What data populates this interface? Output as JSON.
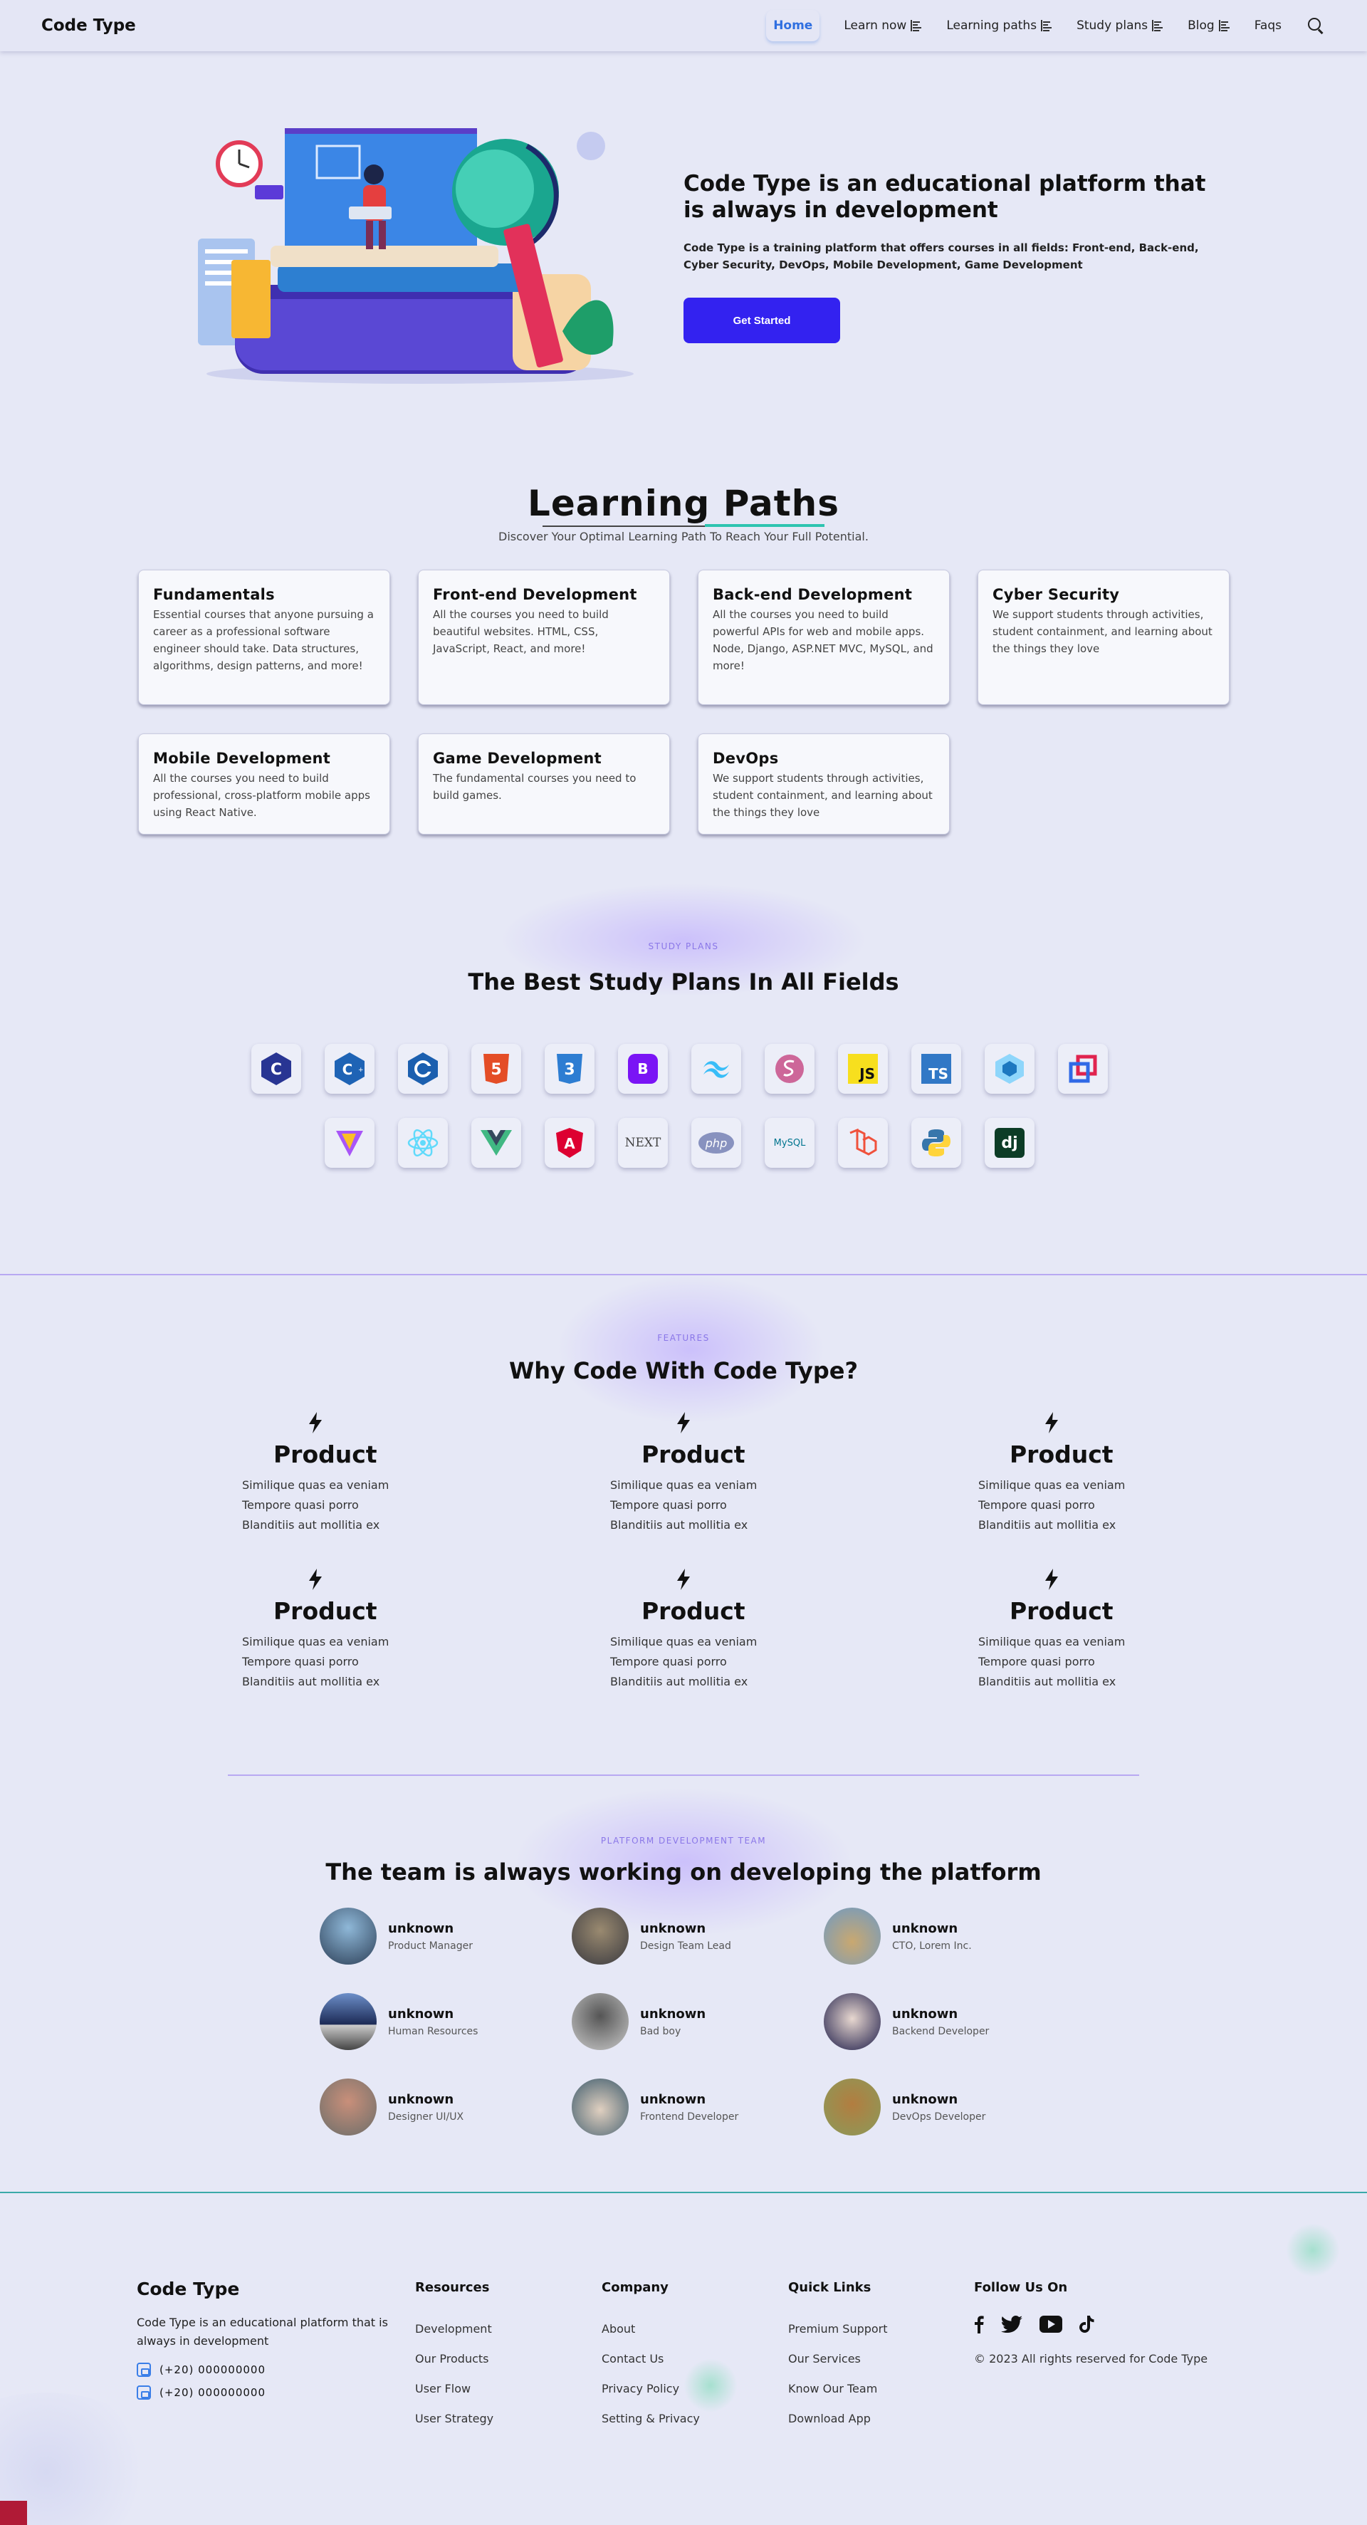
{
  "header": {
    "logo": "Code Type",
    "nav": [
      {
        "label": "Home",
        "active": true,
        "menu": false
      },
      {
        "label": "Learn now",
        "menu": true
      },
      {
        "label": "Learning paths",
        "menu": true
      },
      {
        "label": "Study plans",
        "menu": true
      },
      {
        "label": "Blog",
        "menu": true
      },
      {
        "label": "Faqs",
        "menu": false
      }
    ],
    "search_icon": "search-icon"
  },
  "hero": {
    "title": "Code Type is an educational platform that is always in development",
    "description": "Code Type is a training platform that offers courses in all fields: Front-end, Back-end, Cyber Security, DevOps, Mobile Development, Game Development",
    "cta_label": "Get Started"
  },
  "learning_paths": {
    "title": "Learning Paths",
    "subtitle": "Discover Your Optimal Learning Path To Reach Your Full Potential.",
    "cards": [
      {
        "title": "Fundamentals",
        "desc": "Essential courses that anyone pursuing a career as a professional software engineer should take. Data structures, algorithms, design patterns, and more!"
      },
      {
        "title": "Front-end Development",
        "desc": "All the courses you need to build beautiful websites. HTML, CSS, JavaScript, React, and more!"
      },
      {
        "title": "Back-end Development",
        "desc": "All the courses you need to build powerful APIs for web and mobile apps. Node, Django, ASP.NET MVC, MySQL, and more!"
      },
      {
        "title": "Cyber Security",
        "desc": "We support students through activities, student containment, and learning about the things they love"
      },
      {
        "title": "Mobile Development",
        "desc": "All the courses you need to build professional, cross-platform mobile apps using React Native."
      },
      {
        "title": "Game Development",
        "desc": "The fundamental courses you need to build games."
      },
      {
        "title": "DevOps",
        "desc": "We support students through activities, student containment, and learning about the things they love"
      }
    ]
  },
  "study_plans": {
    "tagline": "STUDY PLANS",
    "title": "The Best Study Plans In All Fields",
    "row1": [
      "c-icon",
      "cpp-icon",
      "csharp-icon",
      "html5-icon",
      "css3-icon",
      "bootstrap-icon",
      "tailwind-icon",
      "sass-icon",
      "javascript-icon",
      "typescript-icon",
      "webpack-icon",
      "redux-icon"
    ],
    "row2": [
      "vite-icon",
      "react-icon",
      "vue-icon",
      "angular-icon",
      "nextjs-icon",
      "php-icon",
      "mysql-icon",
      "laravel-icon",
      "python-icon",
      "django-icon"
    ],
    "labels": {
      "js": "JS",
      "ts": "TS",
      "next": "NEXT",
      "php": "php",
      "mysql": "MySQL",
      "dj": "dj",
      "b": "B",
      "a": "A"
    }
  },
  "features": {
    "tagline": "FEATURES",
    "title": "Why Code With Code Type?",
    "items": [
      {
        "title": "Product",
        "lines": [
          "Similique quas ea veniam",
          "Tempore quasi porro",
          "Blanditiis aut mollitia ex"
        ]
      },
      {
        "title": "Product",
        "lines": [
          "Similique quas ea veniam",
          "Tempore quasi porro",
          "Blanditiis aut mollitia ex"
        ]
      },
      {
        "title": "Product",
        "lines": [
          "Similique quas ea veniam",
          "Tempore quasi porro",
          "Blanditiis aut mollitia ex"
        ]
      },
      {
        "title": "Product",
        "lines": [
          "Similique quas ea veniam",
          "Tempore quasi porro",
          "Blanditiis aut mollitia ex"
        ]
      },
      {
        "title": "Product",
        "lines": [
          "Similique quas ea veniam",
          "Tempore quasi porro",
          "Blanditiis aut mollitia ex"
        ]
      },
      {
        "title": "Product",
        "lines": [
          "Similique quas ea veniam",
          "Tempore quasi porro",
          "Blanditiis aut mollitia ex"
        ]
      }
    ]
  },
  "team": {
    "tagline": "PLATFORM DEVELOPMENT TEAM",
    "title": "The team is always working on developing the platform",
    "members": [
      {
        "name": "unknown",
        "role": "Product Manager"
      },
      {
        "name": "unknown",
        "role": "Design Team Lead"
      },
      {
        "name": "unknown",
        "role": "CTO, Lorem Inc."
      },
      {
        "name": "unknown",
        "role": "Human Resources"
      },
      {
        "name": "unknown",
        "role": "Bad boy"
      },
      {
        "name": "unknown",
        "role": "Backend Developer"
      },
      {
        "name": "unknown",
        "role": "Designer UI/UX"
      },
      {
        "name": "unknown",
        "role": "Frontend Developer"
      },
      {
        "name": "unknown",
        "role": "DevOps Developer"
      }
    ]
  },
  "footer": {
    "brand": "Code Type",
    "about": "Code Type is an educational platform that is always in development",
    "phones": [
      "(+20) 000000000",
      "(+20) 000000000"
    ],
    "columns": [
      {
        "title": "Resources",
        "links": [
          "Development",
          "Our Products",
          "User Flow",
          "User Strategy"
        ]
      },
      {
        "title": "Company",
        "links": [
          "About",
          "Contact Us",
          "Privacy Policy",
          "Setting & Privacy"
        ]
      },
      {
        "title": "Quick Links",
        "links": [
          "Premium Support",
          "Our Services",
          "Know Our Team",
          "Download App"
        ]
      }
    ],
    "follow_title": "Follow Us On",
    "social": [
      "facebook-icon",
      "twitter-icon",
      "youtube-icon",
      "tiktok-icon"
    ],
    "copyright": "© 2023 All rights reserved for Code Type"
  }
}
